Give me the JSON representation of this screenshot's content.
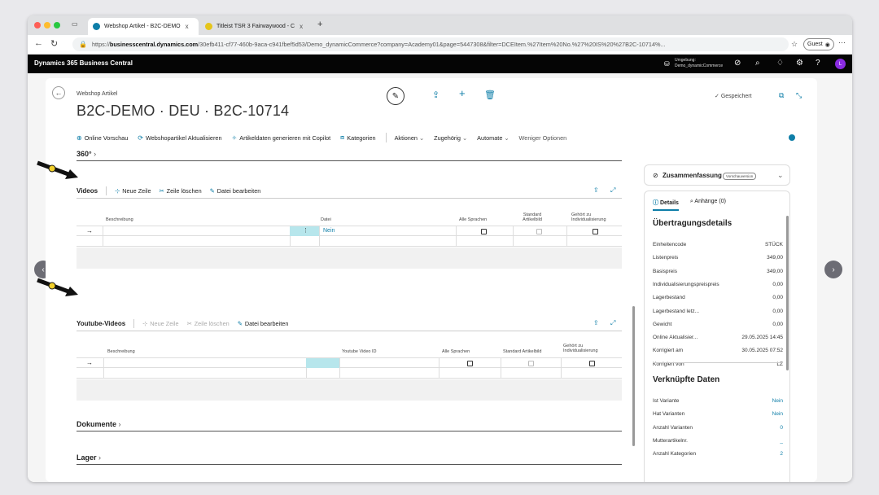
{
  "browser": {
    "tabs": [
      {
        "title": "Webshop Artikel - B2C-DEMO",
        "close": "x"
      },
      {
        "title": "Titleist TSR 3 Fairwaywood - C",
        "close": "x"
      }
    ],
    "new_tab": "+",
    "url_prefix": "https://",
    "url_host": "businesscentral.dynamics.com",
    "url_rest": "/30efb411-cf77-460b-9aca-c941fbef5d53/Demo_dynamicCommerce?company=Academy01&page=5447308&filter=DCEItem.%27Item%20No.%27%20IS%20%27B2C-10714%...",
    "guest_label": "Guest"
  },
  "app": {
    "title": "Dynamics 365 Business Central",
    "env_label": "Umgebung:",
    "env_value": "Demo_dynamicCommerce",
    "avatar": "L"
  },
  "page": {
    "breadcrumb": "Webshop Artikel",
    "title": "B2C-DEMO · DEU · B2C-10714",
    "saved": "Gespeichert"
  },
  "actions": {
    "online_preview": "Online Vorschau",
    "update": "Webshopartikel Aktualisieren",
    "copilot": "Artikeldaten generieren mit Copilot",
    "categories": "Kategorien",
    "actions": "Aktionen",
    "related": "Zugehörig",
    "automate": "Automate",
    "fewer": "Weniger Optionen"
  },
  "sections": {
    "s360": "360°",
    "videos": {
      "title": "Videos",
      "new_row": "Neue Zeile",
      "delete_row": "Zeile löschen",
      "edit_file": "Datei bearbeiten",
      "columns": {
        "desc": "Beschreibung",
        "file": "Datei",
        "all_lang": "Alle Sprachen",
        "std_img_1": "Standard",
        "std_img_2": "Artikelbild",
        "pers_1": "Gehört zu",
        "pers_2": "Individualisierung"
      },
      "row_arrow": "→",
      "row_file_value": "Nein"
    },
    "youtube": {
      "title": "Youtube-Videos",
      "new_row": "Neue Zeile",
      "delete_row": "Zeile löschen",
      "edit_file": "Datei bearbeiten",
      "columns": {
        "desc": "Beschreibung",
        "yt_id": "Youtube Video ID",
        "all_lang": "Alle Sprachen",
        "std_img": "Standard Artikelbild",
        "pers_1": "Gehört zu",
        "pers_2": "Individualisierung"
      },
      "row_arrow": "→"
    },
    "documents": "Dokumente",
    "stock": "Lager"
  },
  "factbox": {
    "title": "Zusammenfassung",
    "badge": "Vorschauversion",
    "tab_details": "Details",
    "tab_attachments": "Anhänge (0)",
    "transfer_title": "Übertragungsdetails",
    "transfer_rows": [
      {
        "label": "Einheitencode",
        "value": "STÜCK"
      },
      {
        "label": "Listenpreis",
        "value": "349,00"
      },
      {
        "label": "Basispreis",
        "value": "349,00"
      },
      {
        "label": "Individualisierungspreispreis",
        "value": "0,00"
      },
      {
        "label": "Lagerbestand",
        "value": "0,00"
      },
      {
        "label": "Lagerbestand letz...",
        "value": "0,00"
      },
      {
        "label": "Gewicht",
        "value": "0,00"
      },
      {
        "label": "Online Aktualisier...",
        "value": "29.05.2025 14:45"
      },
      {
        "label": "Korrigiert am",
        "value": "30.05.2025 07:52"
      },
      {
        "label": "Korrigiert von",
        "value": "LZ"
      }
    ],
    "linked_title": "Verknüpfte Daten",
    "linked_rows": [
      {
        "label": "Ist Variante",
        "value": "Nein"
      },
      {
        "label": "Hat Varianten",
        "value": "Nein"
      },
      {
        "label": "Anzahl Varianten",
        "value": "0"
      },
      {
        "label": "Mutterartikelnr.",
        "value": "_"
      },
      {
        "label": "Anzahl Kategorien",
        "value": "2"
      }
    ]
  },
  "colors": {
    "accent": "#0e7ea8",
    "header_bg": "#050505",
    "selected_cell": "#b7e6ec"
  }
}
